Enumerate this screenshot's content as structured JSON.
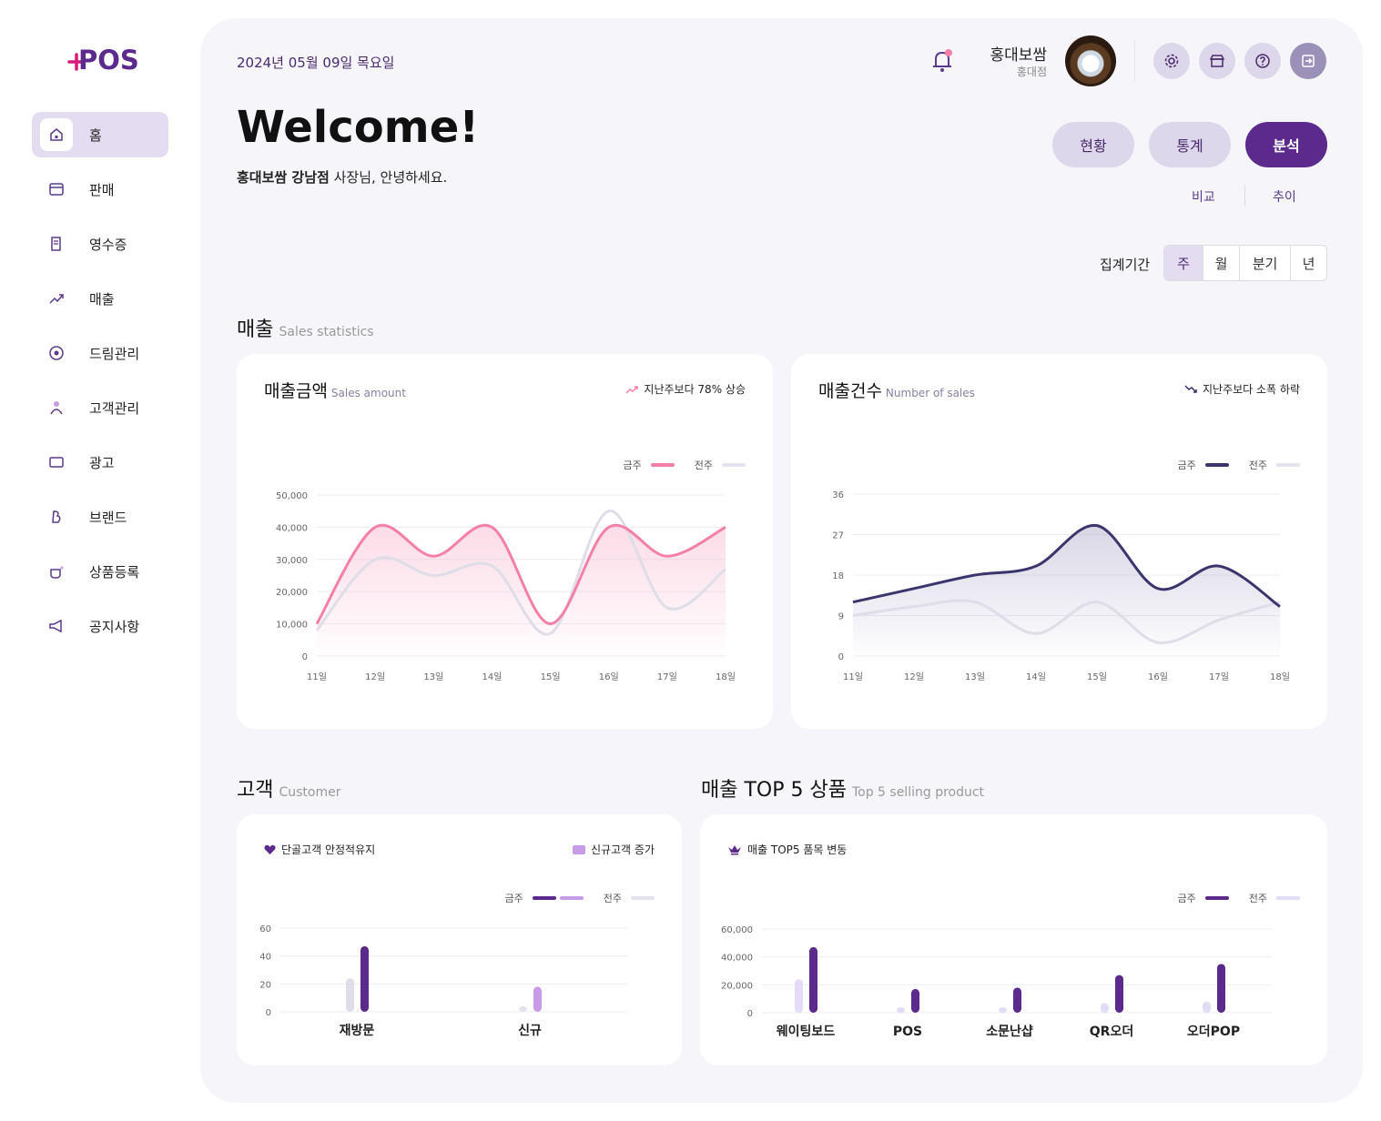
{
  "brand": {
    "logo": "POS"
  },
  "sidebar": {
    "items": [
      {
        "label": "홈",
        "icon": "home-icon"
      },
      {
        "label": "판매",
        "icon": "store-icon"
      },
      {
        "label": "영수증",
        "icon": "receipt-icon"
      },
      {
        "label": "매출",
        "icon": "chart-icon"
      },
      {
        "label": "드림관리",
        "icon": "star-circle-icon"
      },
      {
        "label": "고객관리",
        "icon": "person-icon"
      },
      {
        "label": "광고",
        "icon": "ad-icon"
      },
      {
        "label": "브랜드",
        "icon": "brand-icon"
      },
      {
        "label": "상품등록",
        "icon": "cup-icon"
      },
      {
        "label": "공지사항",
        "icon": "megaphone-icon"
      }
    ]
  },
  "header": {
    "date": "2024년 05월 09일 목요일",
    "user_name": "홍대보쌈",
    "user_branch": "홍대점",
    "title": "Welcome!",
    "greeting_bold": "홍대보쌈 강남점",
    "greeting_rest": " 사장님, 안녕하세요."
  },
  "tabs": {
    "main": [
      "현황",
      "통계",
      "분석"
    ],
    "sub": [
      "비교",
      "추이"
    ]
  },
  "period": {
    "label": "집계기간",
    "options": [
      "주",
      "월",
      "분기",
      "년"
    ],
    "selected": "주"
  },
  "sections": {
    "sales": {
      "title": "매출",
      "subtitle": "Sales statistics"
    },
    "customer": {
      "title": "고객",
      "subtitle": "Customer"
    },
    "top5": {
      "title": "매출 TOP 5 상품",
      "subtitle": "Top 5 selling product"
    }
  },
  "colors": {
    "brand": "#5b2a8c",
    "pink": "#f47fa8",
    "navy": "#3b356e",
    "lavender": "#dcd7ea"
  },
  "chart_data": [
    {
      "type": "line",
      "title": "매출금액",
      "subtitle": "Sales amount",
      "trend": "지난주보다 78% 상승",
      "x": [
        "11일",
        "12일",
        "13일",
        "14일",
        "15일",
        "16일",
        "17일",
        "18일"
      ],
      "yticks": [
        "50,000",
        "40,000",
        "30,000",
        "20,000",
        "10,000",
        "0"
      ],
      "ylim": [
        0,
        50000
      ],
      "series": [
        {
          "name": "금주",
          "values": [
            10000,
            40000,
            31000,
            40000,
            10000,
            40000,
            31000,
            40000
          ]
        },
        {
          "name": "전주",
          "values": [
            8000,
            30000,
            25000,
            28000,
            7000,
            45000,
            15000,
            27000
          ]
        }
      ]
    },
    {
      "type": "line",
      "title": "매출건수",
      "subtitle": "Number of sales",
      "trend": "지난주보다 소폭 하락",
      "x": [
        "11일",
        "12일",
        "13일",
        "14일",
        "15일",
        "16일",
        "17일",
        "18일"
      ],
      "yticks": [
        "36",
        "27",
        "18",
        "9",
        "0"
      ],
      "ylim": [
        0,
        36
      ],
      "series": [
        {
          "name": "금주",
          "values": [
            12,
            15,
            18,
            20,
            29,
            15,
            20,
            11
          ]
        },
        {
          "name": "전주",
          "values": [
            9,
            11,
            12,
            5,
            12,
            3,
            8,
            12
          ]
        }
      ]
    },
    {
      "type": "bar",
      "chips": [
        "단골고객 안정적유지",
        "신규고객 증가"
      ],
      "categories": [
        "재방문",
        "신규"
      ],
      "yticks": [
        "60",
        "40",
        "20",
        "0"
      ],
      "ylim": [
        0,
        60
      ],
      "series": [
        {
          "name": "금주",
          "values": [
            47,
            18
          ]
        },
        {
          "name": "전주",
          "values": [
            24,
            4
          ]
        }
      ]
    },
    {
      "type": "bar",
      "chip": "매출 TOP5 품목 변동",
      "categories": [
        "웨이팅보드",
        "POS",
        "소문난샵",
        "QR오더",
        "오더POP"
      ],
      "yticks": [
        "60,000",
        "40,000",
        "20,000",
        "0"
      ],
      "ylim": [
        0,
        60000
      ],
      "series": [
        {
          "name": "금주",
          "values": [
            47000,
            17000,
            18000,
            27000,
            35000
          ]
        },
        {
          "name": "전주",
          "values": [
            24000,
            4000,
            0,
            7000,
            8000
          ]
        }
      ]
    }
  ]
}
